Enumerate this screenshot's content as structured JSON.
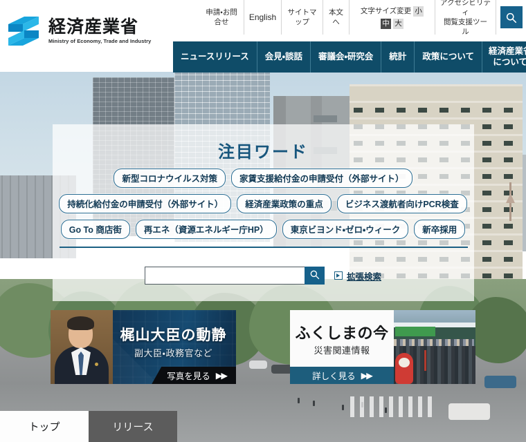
{
  "site": {
    "logo_jp": "経済産業省",
    "logo_en": "Ministry of Economy, Trade and Industry",
    "logo_icon": "meti-s-logo-icon"
  },
  "utility_nav": {
    "items": [
      {
        "label": "申請・お問合せ",
        "name": "util-inquiry"
      },
      {
        "label": "English",
        "name": "util-english"
      },
      {
        "label": "サイトマップ",
        "name": "util-sitemap"
      },
      {
        "label": "本文へ",
        "name": "util-skip-to-content"
      }
    ],
    "font_size": {
      "label": "文字サイズ変更",
      "options": [
        {
          "label": "小",
          "active": false
        },
        {
          "label": "中",
          "active": true
        },
        {
          "label": "大",
          "active": false
        }
      ]
    },
    "accessibility": {
      "line1": "アクセシビリティ",
      "line2": "閲覧支援ツール"
    },
    "search_toggle_icon": "search-icon"
  },
  "main_nav": {
    "items": [
      {
        "label": "ニュースリリース",
        "name": "nav-news-release"
      },
      {
        "label": "会見・談話",
        "name": "nav-press-conference"
      },
      {
        "label": "審議会・研究会",
        "name": "nav-councils"
      },
      {
        "label": "統計",
        "name": "nav-statistics"
      },
      {
        "label": "政策について",
        "name": "nav-policy"
      },
      {
        "label": "経済産業省\nについて",
        "label_line1": "経済産業省",
        "label_line2": "について",
        "name": "nav-about-meti"
      }
    ]
  },
  "hero": {
    "featured_title": "注目ワード",
    "tag_rows": [
      [
        {
          "label": "新型コロナウイルス対策"
        },
        {
          "label": "家賃支援給付金の申請受付（外部サイト）"
        }
      ],
      [
        {
          "label": "持続化給付金の申請受付（外部サイト）"
        },
        {
          "label": "経済産業政策の重点"
        },
        {
          "label": "ビジネス渡航者向けPCR検査"
        }
      ],
      [
        {
          "label": "Go To 商店街"
        },
        {
          "label": "再エネ（資源エネルギー庁HP）"
        },
        {
          "label": "東京ビヨンド・ゼロ・ウィーク"
        },
        {
          "label": "新卒採用"
        }
      ]
    ],
    "search": {
      "value": "",
      "placeholder": "",
      "button_icon": "search-icon",
      "advanced_label": "拡張検索",
      "advanced_icon": "play-triangle-icon"
    }
  },
  "banners": [
    {
      "name": "banner-minister",
      "title": "梶山大臣の動静",
      "subtitle": "副大臣・政務官など",
      "cta": "写真を見る",
      "cta_icon": "double-arrow-icon"
    },
    {
      "name": "banner-fukushima",
      "title": "ふくしまの今",
      "subtitle": "災害関連情報",
      "cta": "詳しく見る",
      "cta_icon": "double-arrow-icon"
    }
  ],
  "bottom_tabs": [
    {
      "label": "トップ",
      "active": true,
      "name": "tab-top"
    },
    {
      "label": "リリース",
      "active": false,
      "name": "tab-release"
    }
  ],
  "colors": {
    "nav_blue": "#0f4c68",
    "accent_blue": "#16618b",
    "title_blue": "#17567d",
    "logo_cyan": "#00a0dd"
  }
}
